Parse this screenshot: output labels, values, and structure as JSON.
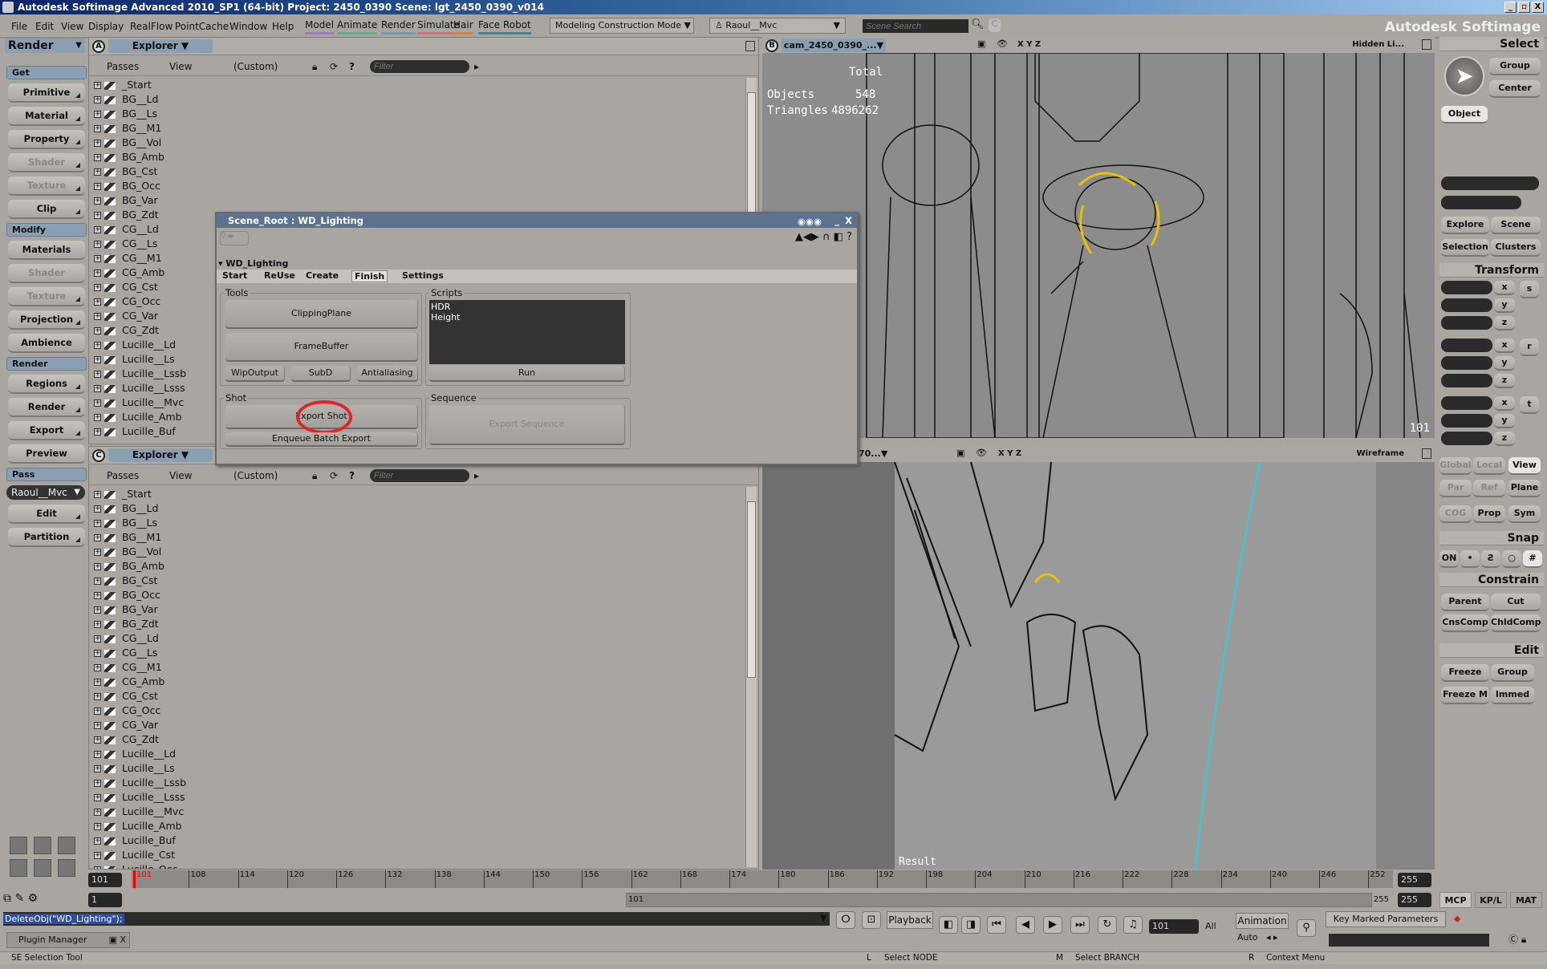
{
  "window": {
    "title": "Autodesk Softimage Advanced 2010_SP1 (64-bit)    Project: 2450_0390    Scene: lgt_2450_0390_v014",
    "minimize": "_",
    "maximize": "▫",
    "close": "X"
  },
  "menubar": {
    "menus": [
      "File",
      "Edit",
      "View",
      "Display",
      "RealFlow",
      "PointCache",
      "Window",
      "Help"
    ],
    "modules": [
      {
        "label": "Model",
        "color": "#9b7fb0"
      },
      {
        "label": "Animate",
        "color": "#6fa58a"
      },
      {
        "label": "Render",
        "color": "#7e95a8"
      },
      {
        "label": "Simulate",
        "color": "#c07a7a"
      },
      {
        "label": "Hair",
        "color": "#c8864f"
      },
      {
        "label": "Face Robot",
        "color": "#4f7f8f"
      }
    ],
    "construction_mode": "Modeling Construction Mode",
    "active_pass": "Raoul__Mvc",
    "scene_search_placeholder": "Scene Search",
    "brand": "Autodesk Softimage"
  },
  "left_toolbar": {
    "mode": "Render",
    "sections": [
      {
        "title": "Get",
        "buttons": [
          {
            "label": "Primitive",
            "menu": true
          },
          {
            "label": "Material",
            "menu": true
          },
          {
            "label": "Property",
            "menu": true
          },
          {
            "label": "Shader",
            "menu": true,
            "disabled": true
          },
          {
            "label": "Texture",
            "menu": true,
            "disabled": true
          },
          {
            "label": "Clip",
            "menu": true
          }
        ]
      },
      {
        "title": "Modify",
        "buttons": [
          {
            "label": "Materials"
          },
          {
            "label": "Shader",
            "disabled": true
          },
          {
            "label": "Texture",
            "menu": true,
            "disabled": true
          },
          {
            "label": "Projection",
            "menu": true
          },
          {
            "label": "Ambience"
          }
        ]
      },
      {
        "title": "Render",
        "buttons": [
          {
            "label": "Regions",
            "menu": true
          },
          {
            "label": "Render",
            "menu": true
          },
          {
            "label": "Export",
            "menu": true
          },
          {
            "label": "Preview"
          }
        ]
      },
      {
        "title": "Pass",
        "current_pass": "Raoul__Mvc",
        "buttons": [
          {
            "label": "Edit",
            "menu": true
          },
          {
            "label": "Partition",
            "menu": true
          }
        ]
      }
    ]
  },
  "explorer_a": {
    "letter": "A",
    "title": "Explorer",
    "passes": "Passes",
    "view": "View",
    "scope": "(Custom)",
    "filter_placeholder": "Filter"
  },
  "explorer_c": {
    "letter": "C",
    "title": "Explorer",
    "passes": "Passes",
    "view": "View",
    "scope": "(Custom)",
    "filter_placeholder": "Filter"
  },
  "pass_list": [
    "_Start",
    "BG__Ld",
    "BG__Ls",
    "BG__M1",
    "BG__Vol",
    "BG_Amb",
    "BG_Cst",
    "BG_Occ",
    "BG_Var",
    "BG_Zdt",
    "CG__Ld",
    "CG__Ls",
    "CG__M1",
    "CG_Amb",
    "CG_Cst",
    "CG_Occ",
    "CG_Var",
    "CG_Zdt",
    "Lucille__Ld",
    "Lucille__Ls",
    "Lucille__Lssb",
    "Lucille__Lsss",
    "Lucille__Mvc",
    "Lucille_Amb",
    "Lucille_Buf",
    "Lucille_Cst",
    "Lucille_Occ"
  ],
  "viewport_b": {
    "letter": "B",
    "camera": "cam_2450_0390_...",
    "axes": "X Y Z",
    "display_mode": "Hidden Li...",
    "stats": {
      "header": "Total",
      "objects_label": "Objects",
      "objects": "548",
      "triangles_label": "Triangles",
      "triangles": "4896262"
    },
    "frame": "101"
  },
  "viewport_d": {
    "camera": "70...",
    "axes": "X Y Z",
    "display_mode": "Wireframe",
    "label": "Result"
  },
  "dialog": {
    "title": "Scene_Root : WD_Lighting",
    "section": "WD_Lighting",
    "tabs": [
      "Start",
      "ReUse",
      "Create",
      "Finish",
      "Settings"
    ],
    "active_tab": "Finish",
    "tools": {
      "label": "Tools",
      "clipping_plane": "ClippingPlane",
      "frame_buffer": "FrameBuffer",
      "wip_output": "WipOutput",
      "subd": "SubD",
      "antialiasing": "Antialiasing"
    },
    "scripts": {
      "label": "Scripts",
      "items": [
        "HDR",
        "Height"
      ],
      "run": "Run"
    },
    "shot": {
      "label": "Shot",
      "export_shot": "Export Shot",
      "enqueue": "Enqueue Batch Export",
      "highlight_color": "#e0242a"
    },
    "sequence": {
      "label": "Sequence",
      "export_sequence": "Export Sequence"
    }
  },
  "right_panel": {
    "select": {
      "title": "Select",
      "group": "Group",
      "center": "Center",
      "object": "Object",
      "explore": "Explore",
      "scene": "Scene",
      "selection": "Selection",
      "clusters": "Clusters"
    },
    "transform": {
      "title": "Transform",
      "axes": [
        "x",
        "y",
        "z"
      ],
      "groups": [
        "s",
        "r",
        "t"
      ],
      "global": "Global",
      "local": "Local",
      "view": "View",
      "par": "Par",
      "ref": "Ref",
      "plane": "Plane",
      "cog": "COG",
      "prop": "Prop",
      "sym": "Sym"
    },
    "snap": {
      "title": "Snap",
      "on": "ON"
    },
    "constrain": {
      "title": "Constrain",
      "parent": "Parent",
      "cut": "Cut",
      "cnscomp": "CnsComp",
      "chldcomp": "ChldComp"
    },
    "edit": {
      "title": "Edit",
      "freeze": "Freeze",
      "group": "Group",
      "freeze_m": "Freeze M",
      "immed": "Immed"
    }
  },
  "timeline": {
    "start": "101",
    "end": "255",
    "current": "101",
    "ticks": [
      "108",
      "114",
      "120",
      "126",
      "132",
      "138",
      "144",
      "150",
      "156",
      "162",
      "168",
      "174",
      "180",
      "186",
      "192",
      "198",
      "204",
      "210",
      "216",
      "222",
      "228",
      "234",
      "240",
      "246",
      "252"
    ],
    "range_start": "1",
    "range_in": "101",
    "range_out": "255",
    "range_end": "255",
    "tabs": [
      "MCP",
      "KP/L",
      "MAT"
    ]
  },
  "bottom": {
    "command": "DeleteObj(\"WD_Lighting\");",
    "playback": "Playback",
    "frame": "101",
    "all": "All",
    "animation": "Animation",
    "auto": "Auto",
    "key_marked": "Key Marked Parameters",
    "plugin_manager": "Plugin Manager"
  },
  "status": {
    "tool": "SE Selection Tool",
    "l": "Select NODE",
    "m": "Select BRANCH",
    "r": "Context Menu"
  }
}
